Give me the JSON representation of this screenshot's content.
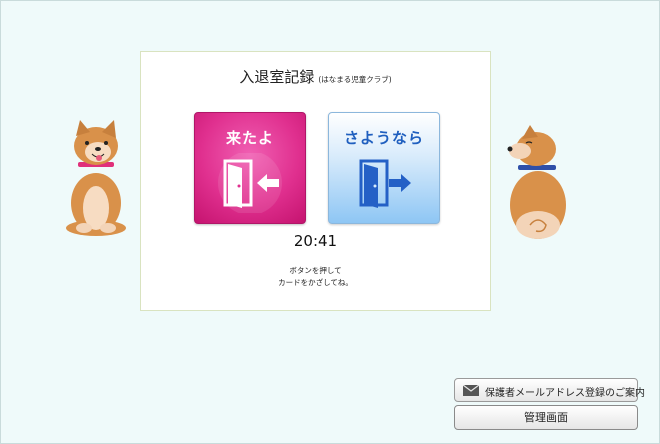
{
  "panel": {
    "title": "入退室記録",
    "subtitle": "(はなまる児童クラブ)",
    "time": "20:41",
    "hint_line1": "ボタンを押して",
    "hint_line2": "カードをかざしてね。"
  },
  "buttons": {
    "checkin_label": "来たよ",
    "checkout_label": "さようなら"
  },
  "footer": {
    "mail_guide_label": "保護者メールアドレス登録のご案内",
    "admin_label": "管理画面"
  },
  "icons": {
    "checkin": "door-enter-icon",
    "checkout": "door-exit-icon",
    "mail": "envelope-icon"
  },
  "colors": {
    "checkin_button": "#e0308f",
    "checkout_button": "#8ec6f4",
    "checkout_text": "#1f5fbf",
    "background": "#effafa"
  }
}
